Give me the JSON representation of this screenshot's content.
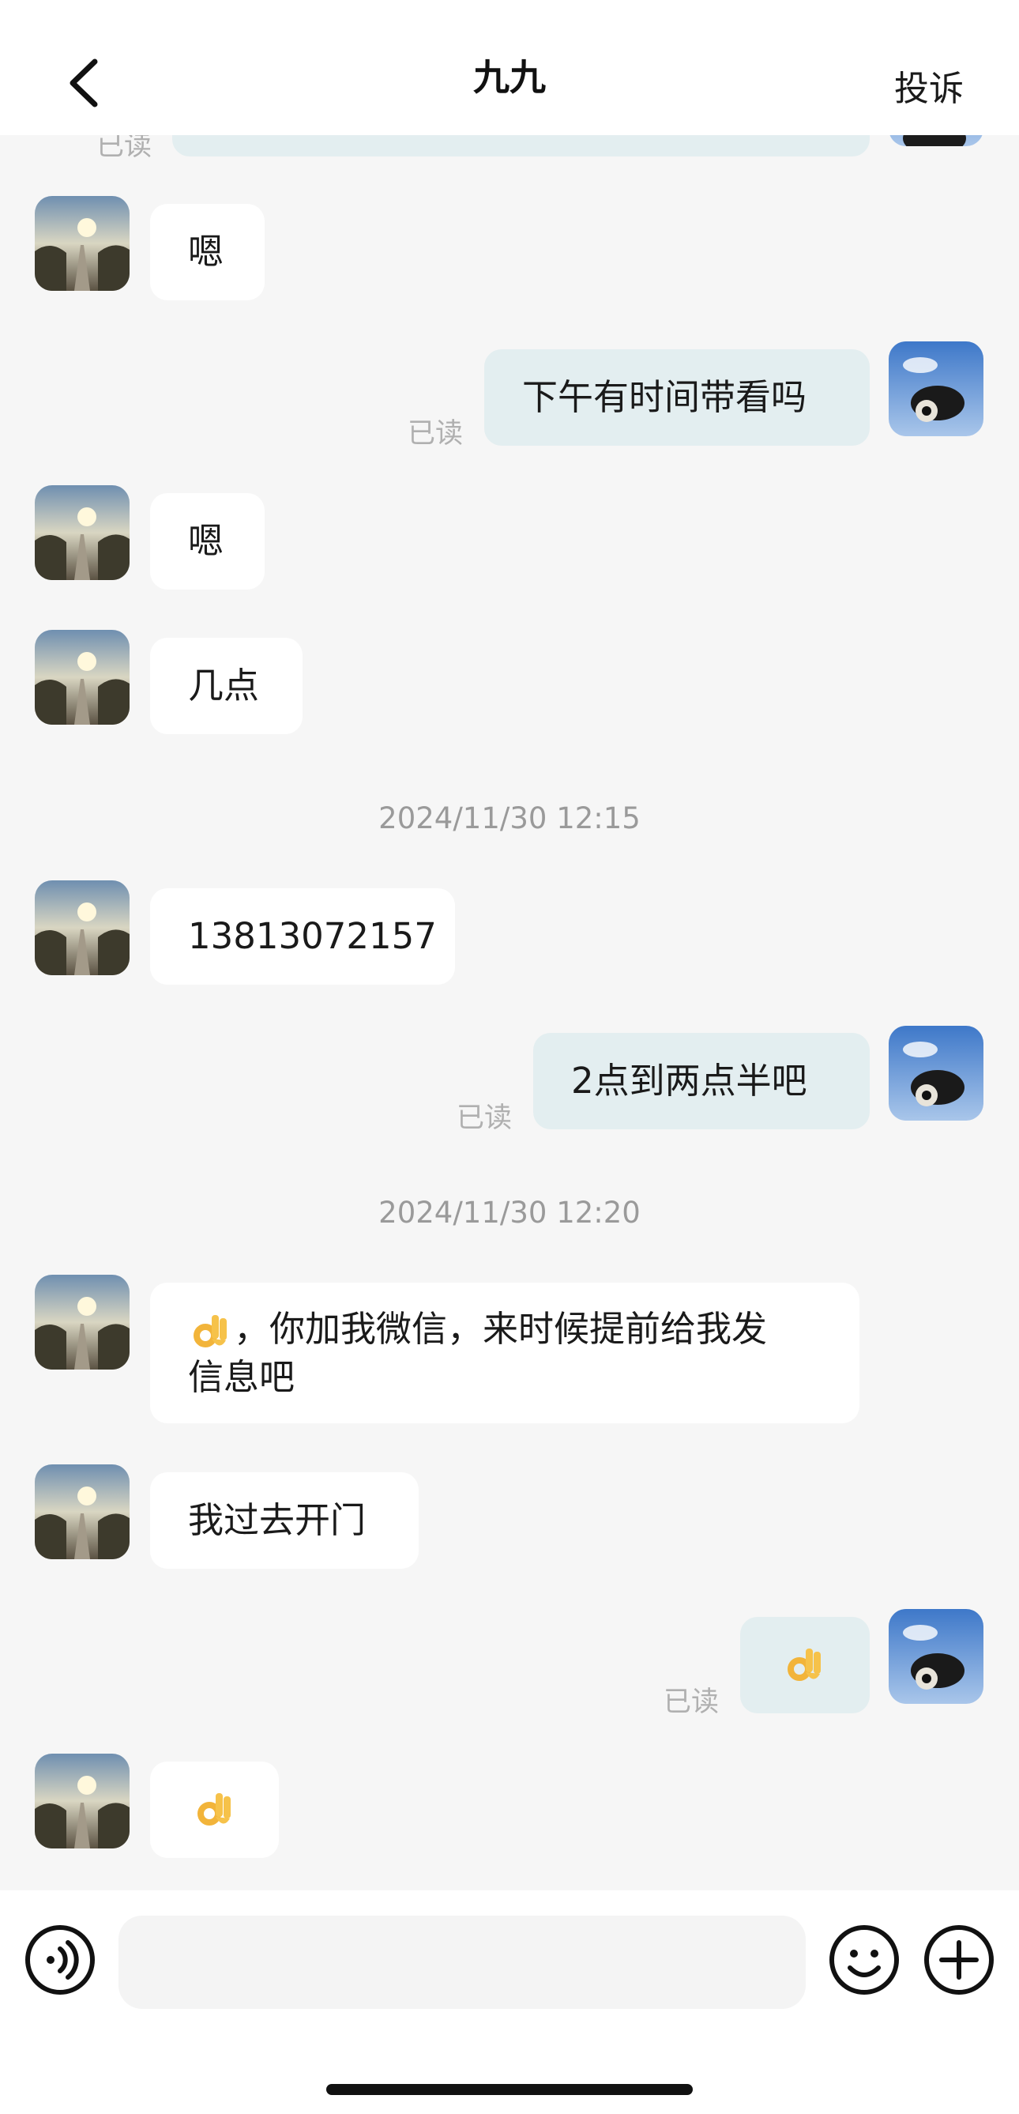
{
  "header": {
    "title": "九九",
    "report_label": "投诉"
  },
  "read_label": "已读",
  "messages": [
    {
      "side": "in",
      "text": "嗯"
    },
    {
      "side": "out",
      "text": "下午有时间带看吗"
    },
    {
      "side": "in",
      "text": "嗯"
    },
    {
      "side": "in",
      "text": "几点"
    },
    {
      "side": "in",
      "text": "13813072157"
    },
    {
      "side": "out",
      "text": "2点到两点半吧"
    },
    {
      "side": "in",
      "text_line1": "，你加我微信，来时候提前给我发",
      "text_line2": "信息吧"
    },
    {
      "side": "in",
      "text": "我过去开门"
    },
    {
      "side": "out",
      "emoji": "ok-hand"
    },
    {
      "side": "in",
      "emoji": "ok-hand"
    }
  ],
  "timestamps": [
    "2024/11/30 12:15",
    "2024/11/30 12:20"
  ],
  "input": {
    "placeholder": ""
  },
  "colors": {
    "incoming_bubble": "#ffffff",
    "outgoing_bubble": "#e3eef0",
    "background": "#f6f6f6"
  }
}
